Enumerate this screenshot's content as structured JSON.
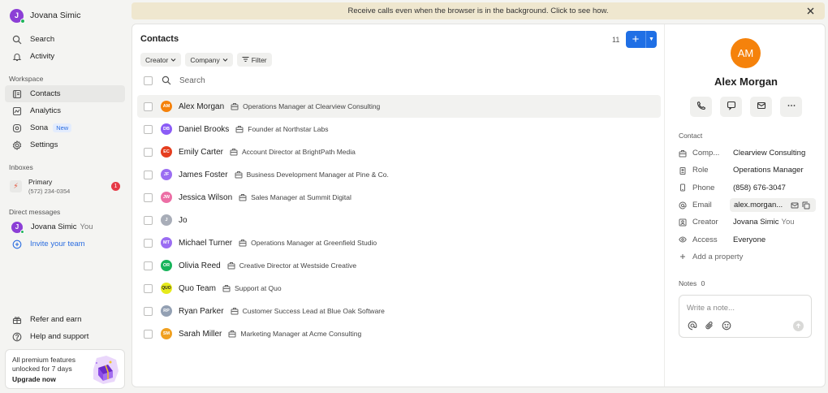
{
  "user": {
    "initial": "J",
    "name": "Jovana Simic"
  },
  "nav": [
    {
      "label": "Search",
      "icon": "search-icon"
    },
    {
      "label": "Activity",
      "icon": "bell-icon"
    }
  ],
  "workspace": {
    "label": "Workspace",
    "items": [
      {
        "label": "Contacts",
        "icon": "contacts-icon",
        "active": true
      },
      {
        "label": "Analytics",
        "icon": "analytics-icon"
      },
      {
        "label": "Sona",
        "icon": "sona-icon",
        "badge": "New"
      },
      {
        "label": "Settings",
        "icon": "gear-icon"
      }
    ]
  },
  "inboxes": {
    "label": "Inboxes",
    "primary": {
      "name": "Primary",
      "phone": "(572) 234-0354",
      "count": "1"
    }
  },
  "direct_messages": {
    "label": "Direct messages",
    "me": {
      "initial": "J",
      "name": "Jovana Simic",
      "suffix": "You"
    },
    "invite": "Invite your team"
  },
  "bottom": {
    "refer": "Refer and earn",
    "help": "Help and support",
    "upgrade_text": "All premium features unlocked for 7 days",
    "upgrade_link": "Upgrade now"
  },
  "banner": {
    "text": "Receive calls even when the browser is in the background. Click to see how."
  },
  "contacts": {
    "title": "Contacts",
    "count": "11",
    "filters": {
      "creator": "Creator",
      "company": "Company",
      "filter": "Filter"
    },
    "search_placeholder": "Search",
    "rows": [
      {
        "initials": "AM",
        "name": "Alex Morgan",
        "company": "Operations Manager at Clearview Consulting",
        "color": "#f5820b",
        "selected": true
      },
      {
        "initials": "DB",
        "name": "Daniel Brooks",
        "company": "Founder at Northstar Labs",
        "color": "#8b5cf6"
      },
      {
        "initials": "EC",
        "name": "Emily Carter",
        "company": "Account Director at BrightPath Media",
        "color": "#e53e1f"
      },
      {
        "initials": "JF",
        "name": "James Foster",
        "company": "Business Development Manager at Pine & Co.",
        "color": "#9b6df2"
      },
      {
        "initials": "JW",
        "name": "Jessica Wilson",
        "company": "Sales Manager at Summit Digital",
        "color": "#ec6fa5"
      },
      {
        "initials": "J",
        "name": "Jo",
        "company": "",
        "color": "#a8adb8"
      },
      {
        "initials": "MT",
        "name": "Michael Turner",
        "company": "Operations Manager at Greenfield Studio",
        "color": "#9b6df2"
      },
      {
        "initials": "OR",
        "name": "Olivia Reed",
        "company": "Creative Director at Westside Creative",
        "color": "#18b45b"
      },
      {
        "initials": "QUO",
        "name": "Quo Team",
        "company": "Support at Quo",
        "color": "#e6ea1c"
      },
      {
        "initials": "RP",
        "name": "Ryan Parker",
        "company": "Customer Success Lead at Blue Oak Software",
        "color": "#93a0b3"
      },
      {
        "initials": "SM",
        "name": "Sarah Miller",
        "company": "Marketing Manager at Acme Consulting",
        "color": "#f0a020"
      }
    ]
  },
  "detail": {
    "initials": "AM",
    "name": "Alex Morgan",
    "contact_label": "Contact",
    "props": [
      {
        "key": "Comp...",
        "value": "Clearview Consulting",
        "icon": "building-icon"
      },
      {
        "key": "Role",
        "value": "Operations Manager",
        "icon": "badge-icon"
      },
      {
        "key": "Phone",
        "value": "(858) 676-3047",
        "icon": "phone-icon"
      },
      {
        "key": "Email",
        "value": "alex.morgan...",
        "icon": "at-icon"
      },
      {
        "key": "Creator",
        "value": "Jovana Simic",
        "suffix": "You",
        "icon": "person-icon"
      },
      {
        "key": "Access",
        "value": "Everyone",
        "icon": "eye-icon"
      }
    ],
    "add_property": "Add a property",
    "notes_label": "Notes",
    "notes_count": "0",
    "note_placeholder": "Write a note..."
  }
}
